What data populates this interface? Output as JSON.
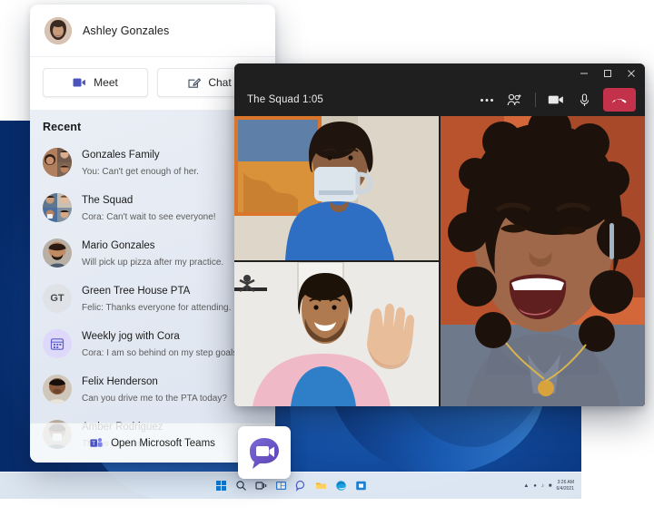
{
  "flyout": {
    "user_name": "Ashley Gonzales",
    "meet_label": "Meet",
    "chat_label": "Chat",
    "recent_heading": "Recent",
    "open_teams_label": "Open Microsoft Teams",
    "items": [
      {
        "name": "Gonzales Family",
        "message": "You: Can't get enough of her.",
        "avatar": "photo-group-a"
      },
      {
        "name": "The Squad",
        "message": "Cora: Can't wait to see everyone!",
        "avatar": "photo-group-b"
      },
      {
        "name": "Mario Gonzales",
        "message": "Will pick up pizza after my practice.",
        "avatar": "photo-mario"
      },
      {
        "name": "Green Tree House PTA",
        "message": "Felic: Thanks everyone for attending.",
        "avatar": "initials",
        "initials": "GT"
      },
      {
        "name": "Weekly jog with Cora",
        "message": "Cora: I am so behind on my step goals.",
        "avatar": "calendar-icon"
      },
      {
        "name": "Felix Henderson",
        "message": "Can you drive me to the PTA today?",
        "avatar": "photo-felix"
      },
      {
        "name": "Amber Rodriguez",
        "message": "That is awesome! Love it!",
        "avatar": "photo-amber"
      }
    ]
  },
  "meeting": {
    "title": "The Squad 1:05",
    "window_controls": [
      "minimize",
      "maximize",
      "close"
    ],
    "tools": [
      "more-options",
      "add-people",
      "camera",
      "microphone",
      "hang-up"
    ],
    "participants": [
      {
        "position": "top-left",
        "description": "woman drinking from white mug, blue shirt"
      },
      {
        "position": "bottom-left",
        "description": "man waving, pink shirt over blue tee"
      },
      {
        "position": "right",
        "description": "woman laughing, curly hair, grey top"
      }
    ]
  },
  "taskbar": {
    "icons": [
      "start-icon",
      "search-icon",
      "task-view-icon",
      "widgets-icon",
      "chat-icon",
      "file-explorer-icon",
      "edge-icon",
      "store-icon"
    ],
    "tray_icons": [
      "chevron-up-icon",
      "network-icon",
      "volume-icon",
      "battery-icon"
    ],
    "clock_time": "3:26 AM",
    "clock_date": "6/4/2021"
  },
  "colors": {
    "teams_purple": "#5b5fc7",
    "hangup_red": "#c4314b",
    "window_dark": "#1f1f1f",
    "accent_blue": "#1f64bd"
  }
}
